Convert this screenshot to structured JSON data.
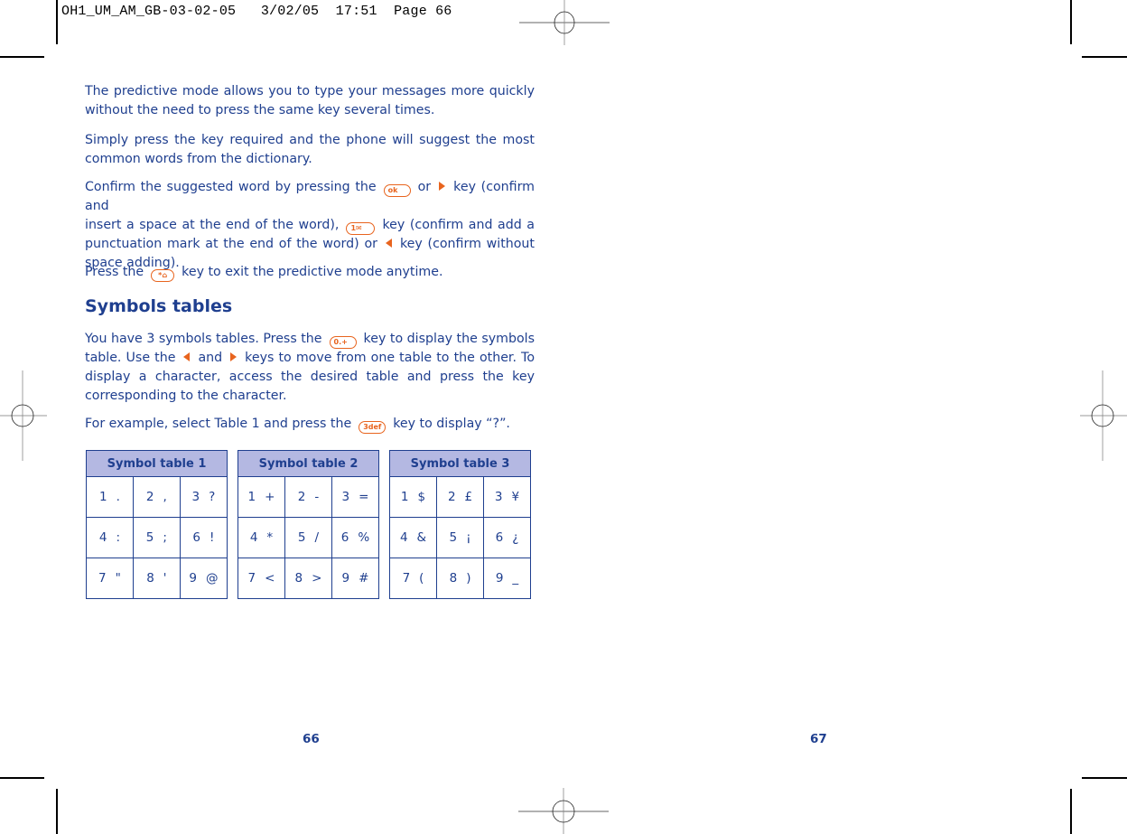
{
  "slug": {
    "file": "OH1_UM_AM_GB-03-02-05",
    "date": "3/02/05",
    "time": "17:51",
    "page_label": "Page 66"
  },
  "paragraphs": {
    "p1": {
      "lines": [
        "The predictive mode allows you to type your messages more quickly",
        "without the need to press the same key several times."
      ]
    },
    "p2": {
      "lines": [
        "Simply press the key required and the phone will suggest the most",
        "common words from the dictionary."
      ]
    },
    "p3": {
      "l1_a": "Confirm the suggested word by pressing the",
      "l1_b": "or",
      "l1_c": "key (confirm and",
      "l2_a": "insert a space at the end of the word),",
      "l2_b": "key (confirm and add a",
      "l3_a": "punctuation mark at the end of the word) or",
      "l3_b": "key (confirm without",
      "l4": "space adding)."
    },
    "p4": {
      "a": "Press the",
      "b": "key to exit the predictive mode anytime."
    },
    "heading": "Symbols tables",
    "p5": {
      "l1_a": "You have 3 symbols tables. Press the",
      "l1_b": "key to display the symbols",
      "l2_a": "table. Use the",
      "l2_b": "and",
      "l2_c": "keys to move from one table to the other. To",
      "l3": "display a character, access the desired table and press the key",
      "l4": "corresponding to the character."
    },
    "p6": {
      "a": "For example, select Table 1 and press the",
      "b": "key to display “?”."
    }
  },
  "keys": {
    "ok": "ok",
    "one": "1✉",
    "star": "*⌂",
    "zero": "0.+",
    "three": "3def",
    "right_arrow": "right-arrow-key",
    "left_arrow": "left-arrow-key"
  },
  "symbol_tables": [
    {
      "title": "Symbol table 1",
      "rows": [
        [
          {
            "n": "1",
            "s": "."
          },
          {
            "n": "2",
            "s": ","
          },
          {
            "n": "3",
            "s": "?"
          }
        ],
        [
          {
            "n": "4",
            "s": ":"
          },
          {
            "n": "5",
            "s": ";"
          },
          {
            "n": "6",
            "s": "!"
          }
        ],
        [
          {
            "n": "7",
            "s": "\""
          },
          {
            "n": "8",
            "s": "'"
          },
          {
            "n": "9",
            "s": "@"
          }
        ]
      ]
    },
    {
      "title": "Symbol table 2",
      "rows": [
        [
          {
            "n": "1",
            "s": "+"
          },
          {
            "n": "2",
            "s": "-"
          },
          {
            "n": "3",
            "s": "="
          }
        ],
        [
          {
            "n": "4",
            "s": "*"
          },
          {
            "n": "5",
            "s": "/"
          },
          {
            "n": "6",
            "s": "%"
          }
        ],
        [
          {
            "n": "7",
            "s": "<"
          },
          {
            "n": "8",
            "s": ">"
          },
          {
            "n": "9",
            "s": "#"
          }
        ]
      ]
    },
    {
      "title": "Symbol table 3",
      "rows": [
        [
          {
            "n": "1",
            "s": "$"
          },
          {
            "n": "2",
            "s": "£"
          },
          {
            "n": "3",
            "s": "¥"
          }
        ],
        [
          {
            "n": "4",
            "s": "&"
          },
          {
            "n": "5",
            "s": "¡"
          },
          {
            "n": "6",
            "s": "¿"
          }
        ],
        [
          {
            "n": "7",
            "s": "("
          },
          {
            "n": "8",
            "s": ")"
          },
          {
            "n": "9",
            "s": "_"
          }
        ]
      ]
    }
  ],
  "page_numbers": {
    "left": "66",
    "right": "67"
  },
  "colors": {
    "text": "#1f3f8f",
    "accent_key": "#e8641e",
    "table_header": "#b4b8e2"
  }
}
